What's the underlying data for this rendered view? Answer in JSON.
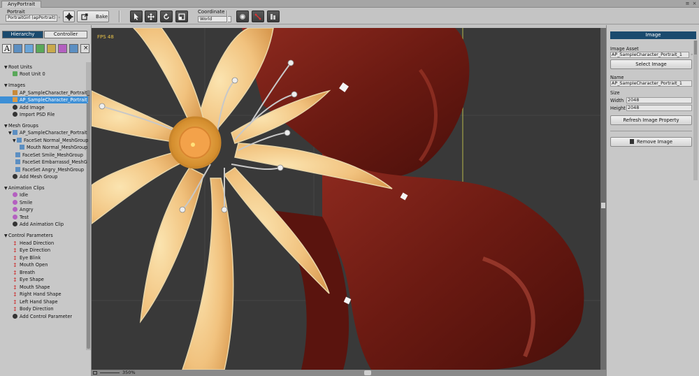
{
  "window": {
    "tab_title": "AnyPortrait"
  },
  "toolbar": {
    "portrait_label": "Portrait",
    "portrait_value": "PortraitGirl (apPortrait)",
    "bake_label": "Bake",
    "coordinate_label": "Coordinate",
    "coordinate_value": "World"
  },
  "left_panel": {
    "tabs": [
      "Hierarchy",
      "Controller"
    ],
    "sections": {
      "root_units": "Root Units",
      "images": "Images",
      "mesh_groups": "Mesh Groups",
      "animation_clips": "Animation Clips",
      "control_parameters": "Control Parameters"
    },
    "root_units": [
      "Root Unit 0"
    ],
    "images": [
      "AP_SampleCharacter_Portrait_0",
      "AP_SampleCharacter_Portrait_1"
    ],
    "images_actions": [
      "Add Image",
      "Import PSD File"
    ],
    "mesh_groups": [
      "AP_SampleCharacter_Portrait",
      "FaceSet Normal_MeshGroup",
      "Mouth Normal_MeshGroup",
      "FaceSet Smile_MeshGroup",
      "FaceSet Embarrassd_MeshGroup",
      "FaceSet Angry_MeshGroup"
    ],
    "mesh_groups_action": "Add Mesh Group",
    "animation_clips": [
      "Idle",
      "Smile",
      "Angry",
      "Test"
    ],
    "animation_action": "Add Animation Clip",
    "control_parameters": [
      "Head Direction",
      "Eye Direction",
      "Eye Blink",
      "Mouth Open",
      "Breath",
      "Eye Shape",
      "Mouth Shape",
      "Right Hand Shape",
      "Left Hand Shape",
      "Body Direction"
    ],
    "control_action": "Add Control Parameter"
  },
  "canvas": {
    "fps": "FPS 48",
    "zoom": "350%"
  },
  "right_panel": {
    "header": "Image",
    "image_asset_label": "Image Asset",
    "image_asset_value": "AP_SampleCharacter_Portrait_1",
    "select_image": "Select Image",
    "name_label": "Name",
    "name_value": "AP_SampleCharacter_Portrait_1",
    "size_label": "Size",
    "width_label": "Width",
    "width_value": "2048",
    "height_label": "Height",
    "height_value": "2048",
    "refresh": "Refresh Image Property",
    "remove": "Remove Image"
  },
  "colors": {
    "selected_row": "#3d8fd6",
    "panel_header": "#1a4a6e",
    "canvas_bg": "#393939",
    "ribbon": "#7a1f17",
    "petal": "#f2c983"
  }
}
